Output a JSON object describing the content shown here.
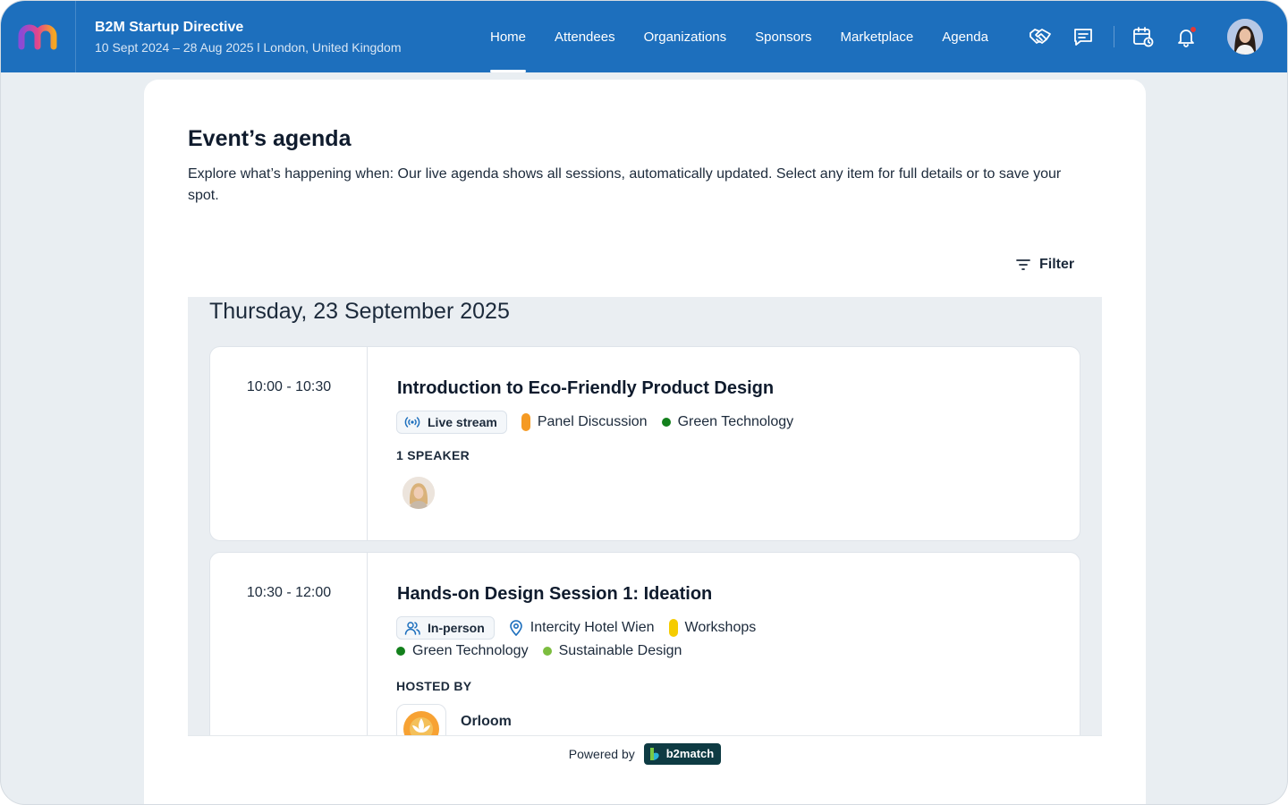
{
  "header": {
    "event_title": "B2M Startup Directive",
    "event_subtitle": "10 Sept 2024 – 28 Aug 2025 l London, United Kingdom",
    "nav": [
      "Home",
      "Attendees",
      "Organizations",
      "Sponsors",
      "Marketplace",
      "Agenda"
    ],
    "active_nav": "Home",
    "icons": [
      "handshake-icon",
      "chat-icon",
      "calendar-clock-icon",
      "bell-icon"
    ],
    "colors": {
      "brand": "#1d6fbd",
      "notification": "#e53935"
    }
  },
  "page": {
    "title": "Event’s agenda",
    "description": "Explore what’s happening when: Our live agenda shows all sessions, automatically updated. Select any item for full details or to save your spot.",
    "filter_label": "Filter"
  },
  "agenda": {
    "day": "Thursday, 23 September 2025",
    "sessions": [
      {
        "time": "10:00 - 10:30",
        "title": "Introduction to Eco-Friendly Product Design",
        "mode": "Live stream",
        "type": "Panel Discussion",
        "type_color": "#f59a23",
        "topics": [
          {
            "label": "Green Technology",
            "color": "#13801c"
          }
        ],
        "section_label": "1 SPEAKER"
      },
      {
        "time": "10:30 - 12:00",
        "title": "Hands-on Design Session 1: Ideation",
        "mode": "In-person",
        "location": "Intercity Hotel Wien",
        "type": "Workshops",
        "type_color": "#f5cc00",
        "topics": [
          {
            "label": "Green Technology",
            "color": "#13801c"
          },
          {
            "label": "Sustainable Design",
            "color": "#7cbd3f"
          }
        ],
        "section_label": "HOSTED BY",
        "host": "Orloom"
      }
    ]
  },
  "footer": {
    "powered_by": "Powered by",
    "brand": "b2match"
  }
}
